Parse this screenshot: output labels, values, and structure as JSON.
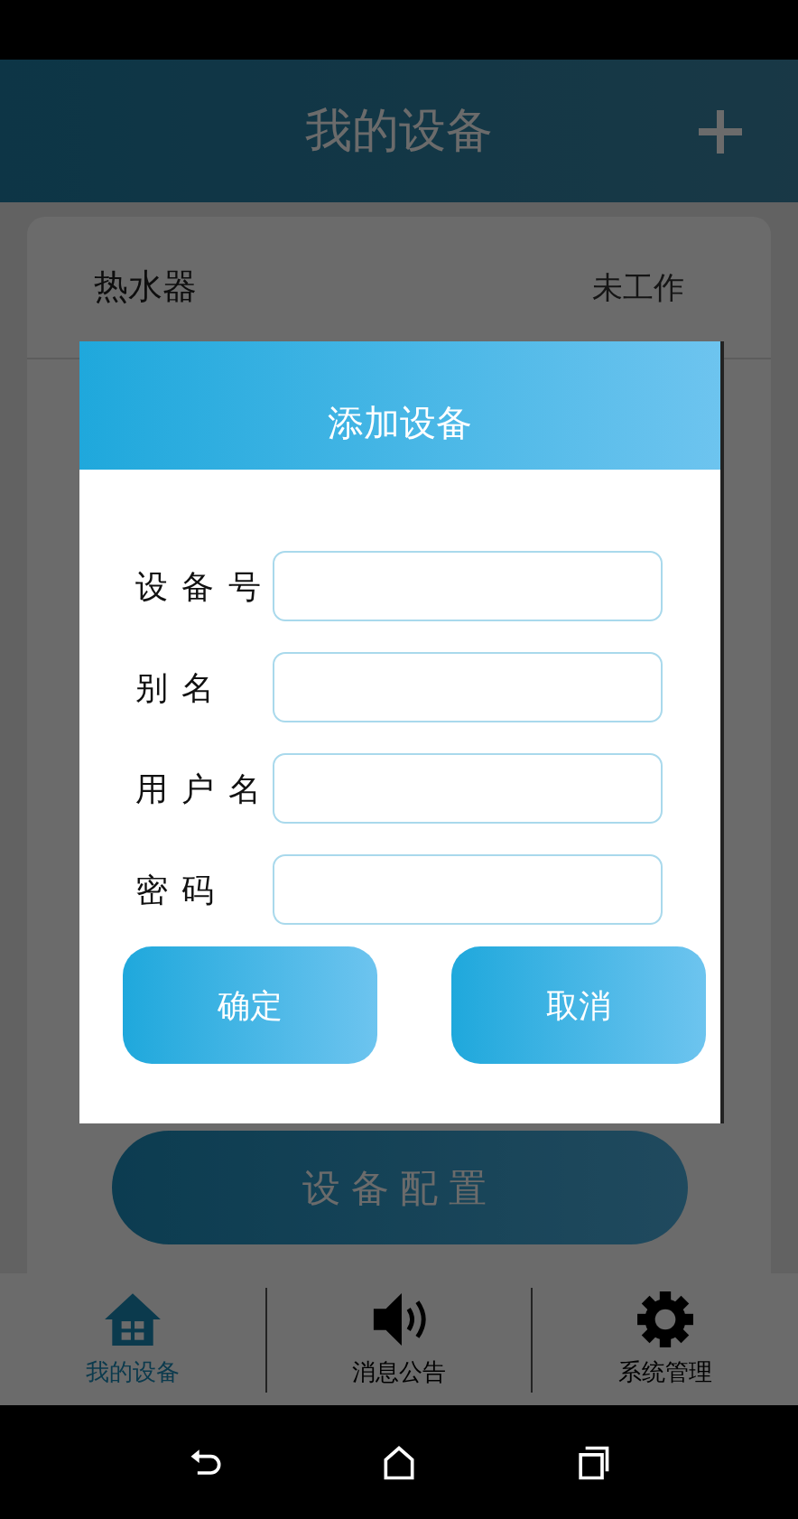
{
  "header": {
    "title": "我的设备"
  },
  "devices": [
    {
      "name": "热水器",
      "status": "未工作"
    }
  ],
  "config_button": "设备配置",
  "tab_bar": [
    {
      "label": "我的设备",
      "selected": true
    },
    {
      "label": "消息公告",
      "selected": false
    },
    {
      "label": "系统管理",
      "selected": false
    }
  ],
  "dialog": {
    "title": "添加设备",
    "fields": [
      {
        "label": "设 备 号"
      },
      {
        "label": "别 名"
      },
      {
        "label": "用 户 名"
      },
      {
        "label": "密 码"
      }
    ],
    "buttons": [
      "确定",
      "取消"
    ]
  }
}
